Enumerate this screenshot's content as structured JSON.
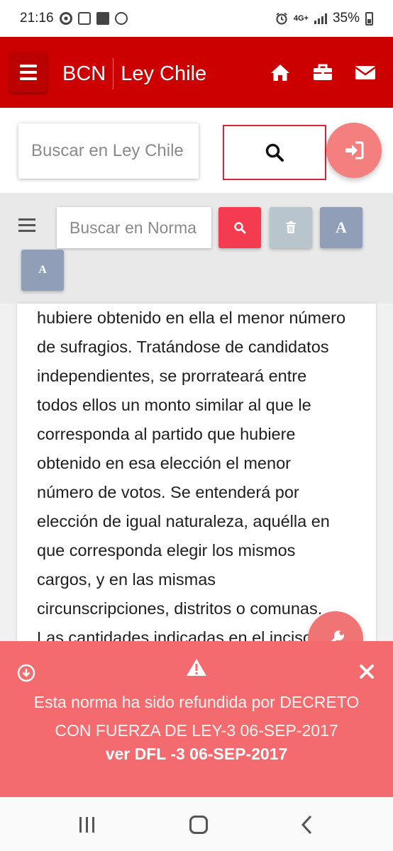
{
  "status_bar": {
    "time": "21:16",
    "network": "4G+",
    "battery": "35%",
    "icons": [
      "chrome-icon",
      "box-icon",
      "gallery-icon",
      "whatsapp-icon",
      "alarm-icon",
      "signal-icon",
      "battery-icon"
    ]
  },
  "header": {
    "brand_short": "BCN",
    "brand_name": "Ley Chile",
    "background": "#cc0000",
    "icons": [
      "menu-icon",
      "home-icon",
      "briefcase-icon",
      "mail-icon"
    ]
  },
  "search": {
    "placeholder": "Buscar en Ley Chile",
    "button_icon": "search-icon",
    "login_icon": "login-icon"
  },
  "toolbar": {
    "placeholder": "Buscar en Norma",
    "font_up_label": "A",
    "font_down_label": "A",
    "icons": [
      "menu-icon",
      "search-icon",
      "trash-icon"
    ]
  },
  "article": {
    "lines": [
      "hubiere obtenido en ella el menor número",
      "de sufragios. Tratándose de candidatos",
      "independientes, se prorrateará entre",
      "todos ellos un monto similar al que le",
      "corresponda al partido que hubiere",
      "obtenido en esa elección el menor",
      "número de votos. Se entenderá por",
      "elección de igual naturaleza, aquélla en",
      "que corresponda elegir los mismos",
      "cargos, y en las mismas",
      "circunscripciones, distritos o comunas.",
      "Las cantidades indicadas en el inciso"
    ]
  },
  "notice": {
    "message_line1": "Esta norma ha sido refundida por DECRETO",
    "message_line2": "CON FUERZA DE LEY-3 06-SEP-2017",
    "link": "ver DFL -3 06-SEP-2017",
    "background": "#f36b6e"
  },
  "nav_bar": {
    "icons": [
      "recent-apps-icon",
      "home-button-icon",
      "back-icon"
    ]
  }
}
